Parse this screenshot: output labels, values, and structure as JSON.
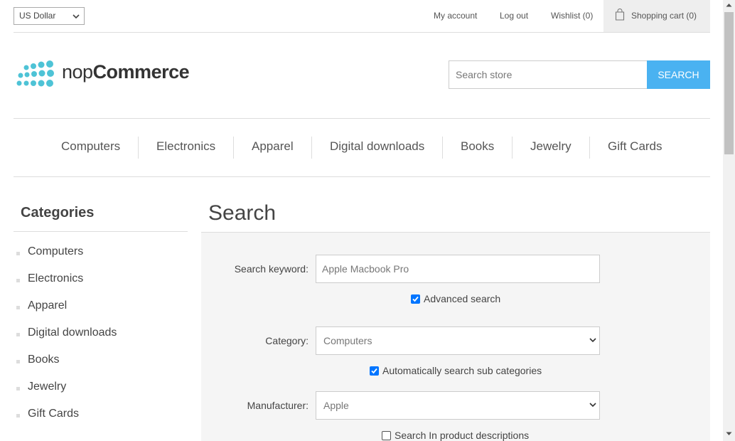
{
  "header": {
    "currency": "US Dollar",
    "links": {
      "my_account": "My account",
      "log_out": "Log out",
      "wishlist": "Wishlist (0)",
      "shopping_cart": "Shopping cart (0)"
    }
  },
  "logo": {
    "brand_light": "nop",
    "brand_bold": "Commerce",
    "color": "#4ec3d6"
  },
  "search_box": {
    "placeholder": "Search store",
    "button_label": "SEARCH",
    "button_color": "#4ab2f1"
  },
  "menu": {
    "items": [
      "Computers",
      "Electronics",
      "Apparel",
      "Digital downloads",
      "Books",
      "Jewelry",
      "Gift Cards"
    ]
  },
  "sidebar": {
    "title": "Categories",
    "items": [
      "Computers",
      "Electronics",
      "Apparel",
      "Digital downloads",
      "Books",
      "Jewelry",
      "Gift Cards"
    ]
  },
  "search_page": {
    "title": "Search",
    "keyword_label": "Search keyword:",
    "keyword_value": "Apple Macbook Pro",
    "advanced_search_label": "Advanced search",
    "advanced_search_checked": true,
    "category_label": "Category:",
    "category_value": "Computers",
    "auto_subcategories_label": "Automatically search sub categories",
    "auto_subcategories_checked": true,
    "manufacturer_label": "Manufacturer:",
    "manufacturer_value": "Apple",
    "descriptions_label": "Search In product descriptions",
    "descriptions_checked": false
  }
}
